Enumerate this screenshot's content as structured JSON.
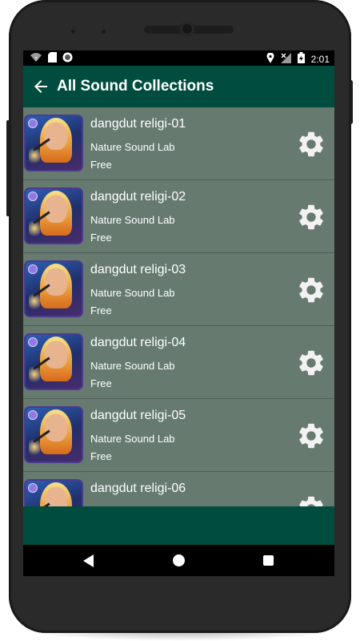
{
  "status_bar": {
    "time": "2:01",
    "left_icons": [
      "wifi-question-icon",
      "sd-card-icon",
      "record-icon"
    ],
    "right_icons": [
      "location-icon",
      "no-signal-icon",
      "battery-charging-icon"
    ]
  },
  "app_bar": {
    "title": "All Sound Collections",
    "back_icon": "arrow-left-icon",
    "color": "#004d40"
  },
  "list": {
    "background": "#667a70",
    "items": [
      {
        "title": "dangdut religi-01",
        "subtitle": "Nature Sound Lab",
        "price": "Free",
        "action_icon": "gear-icon"
      },
      {
        "title": "dangdut religi-02",
        "subtitle": "Nature Sound Lab",
        "price": "Free",
        "action_icon": "gear-icon"
      },
      {
        "title": "dangdut religi-03",
        "subtitle": "Nature Sound Lab",
        "price": "Free",
        "action_icon": "gear-icon"
      },
      {
        "title": "dangdut religi-04",
        "subtitle": "Nature Sound Lab",
        "price": "Free",
        "action_icon": "gear-icon"
      },
      {
        "title": "dangdut religi-05",
        "subtitle": "Nature Sound Lab",
        "price": "Free",
        "action_icon": "gear-icon"
      },
      {
        "title": "dangdut religi-06",
        "subtitle": "",
        "price": "",
        "action_icon": "gear-icon"
      }
    ]
  },
  "nav_bar": {
    "icons": [
      "nav-back-icon",
      "nav-home-icon",
      "nav-recents-icon"
    ]
  }
}
